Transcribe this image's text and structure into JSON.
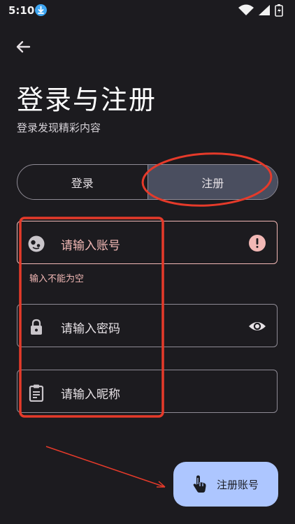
{
  "status_bar": {
    "time": "5:10"
  },
  "header": {
    "title": "登录与注册",
    "subtitle": "登录发现精彩内容"
  },
  "tabs": [
    {
      "label": "登录",
      "active": false
    },
    {
      "label": "注册",
      "active": true
    }
  ],
  "form": {
    "account": {
      "placeholder": "请输入账号",
      "error": "输入不能为空"
    },
    "password": {
      "placeholder": "请输入密码"
    },
    "nickname": {
      "placeholder": "请输入昵称"
    }
  },
  "fab": {
    "label": "注册账号"
  },
  "icons": {
    "back": "arrow-back-icon",
    "account": "face-icon",
    "error": "error-icon",
    "password": "lock-icon",
    "visibility": "eye-icon",
    "nickname": "clipboard-icon",
    "fab": "touch-icon"
  },
  "colors": {
    "background": "#1c1b1f",
    "error": "#f2b8b5",
    "fab": "#adc6ff",
    "tab_active": "#4a4e5f",
    "annotation": "#e53a2a"
  }
}
